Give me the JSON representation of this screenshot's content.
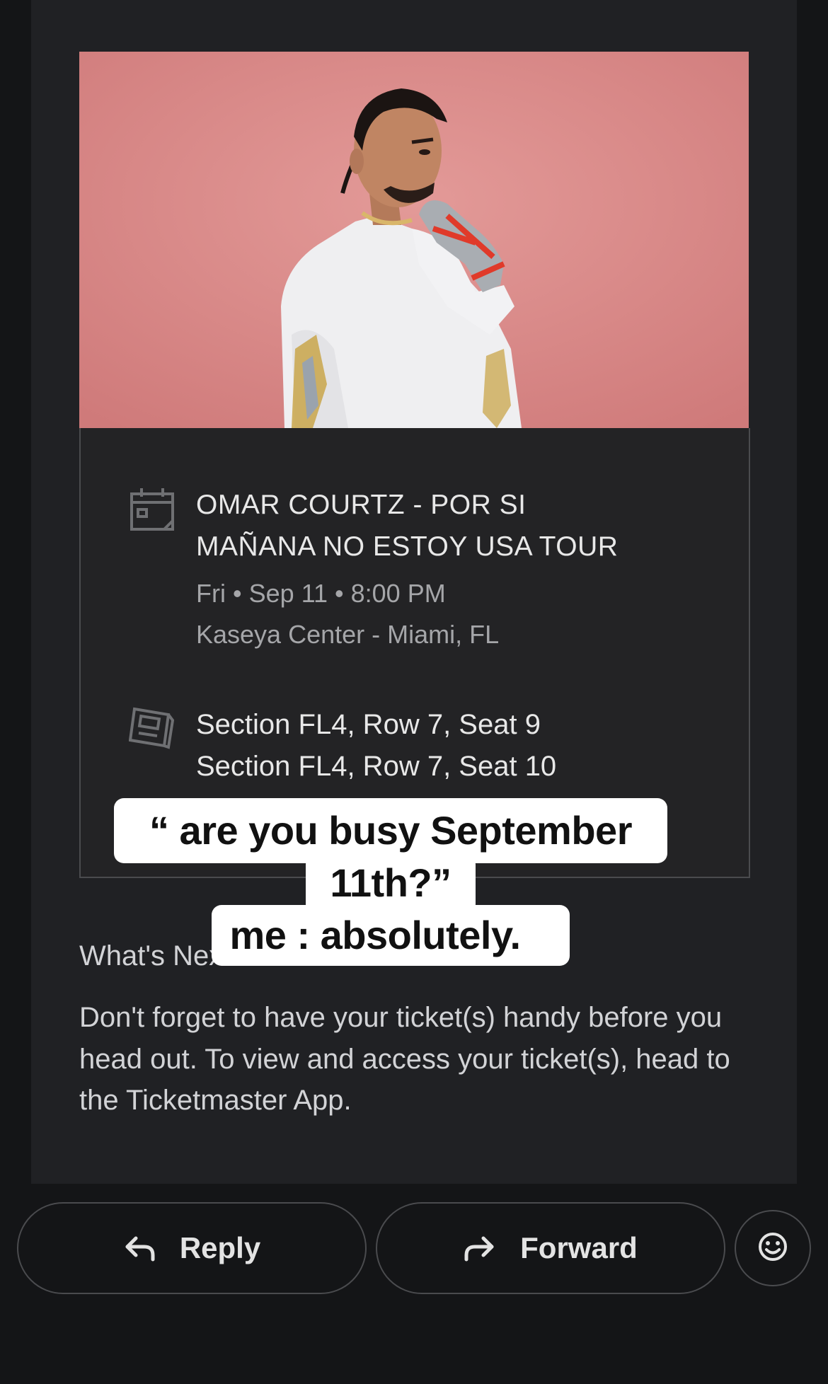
{
  "event": {
    "title_line1": "OMAR COURTZ - POR SI",
    "title_line2": "MAÑANA NO ESTOY USA TOUR",
    "datetime": "Fri • Sep 11 • 8:00 PM",
    "venue": "Kaseya Center - Miami, FL"
  },
  "seats": [
    "Section FL4, Row 7, Seat 9",
    "Section FL4, Row 7, Seat 10"
  ],
  "caption": {
    "line1": "“ are you busy September",
    "line2": "11th?”",
    "line3": "me : absolutely."
  },
  "next": {
    "heading": "What's Next?",
    "body": "Don't forget to have your ticket(s) handy before you head out. To view and access your ticket(s), head to the Ticketmaster App."
  },
  "actions": {
    "reply_label": "Reply",
    "forward_label": "Forward",
    "reply_icon": "reply-arrow-icon",
    "forward_icon": "forward-arrow-icon",
    "emoji_icon": "smiley-icon"
  },
  "icons": {
    "event_icon": "calendar-icon",
    "seat_icon": "ticket-icon"
  },
  "colors": {
    "background": "#141517",
    "card": "#202124",
    "hero_backdrop": "#d88484",
    "caption_bg": "#ffffff"
  }
}
